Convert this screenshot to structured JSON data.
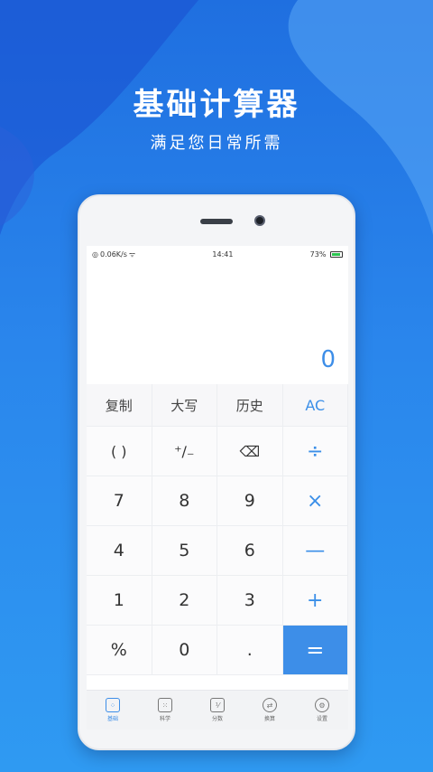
{
  "promo": {
    "title": "基础计算器",
    "subtitle": "满足您日常所需"
  },
  "status": {
    "speed": "0.06K/s",
    "time": "14:41",
    "battery": "73%"
  },
  "display": {
    "value": "0"
  },
  "function_row": [
    {
      "label": "复制"
    },
    {
      "label": "大写"
    },
    {
      "label": "历史"
    },
    {
      "label": "AC"
    }
  ],
  "keys": [
    {
      "label": "( )"
    },
    {
      "label": "⁺∕₋"
    },
    {
      "label": "⌫"
    },
    {
      "label": "÷"
    },
    {
      "label": "7"
    },
    {
      "label": "8"
    },
    {
      "label": "9"
    },
    {
      "label": "×"
    },
    {
      "label": "4"
    },
    {
      "label": "5"
    },
    {
      "label": "6"
    },
    {
      "label": "—"
    },
    {
      "label": "1"
    },
    {
      "label": "2"
    },
    {
      "label": "3"
    },
    {
      "label": "+"
    },
    {
      "label": "%"
    },
    {
      "label": "0"
    },
    {
      "label": "."
    },
    {
      "label": "="
    }
  ],
  "tabs": [
    {
      "label": "基础",
      "icon": "basic-calc-icon",
      "active": true
    },
    {
      "label": "科学",
      "icon": "scientific-icon",
      "active": false
    },
    {
      "label": "分数",
      "icon": "fraction-icon",
      "active": false
    },
    {
      "label": "换算",
      "icon": "convert-icon",
      "active": false
    },
    {
      "label": "设置",
      "icon": "settings-icon",
      "active": false
    }
  ],
  "colors": {
    "accent": "#3d8ee8",
    "background_top": "#1f6fe0",
    "background_bottom": "#2f9af2"
  }
}
